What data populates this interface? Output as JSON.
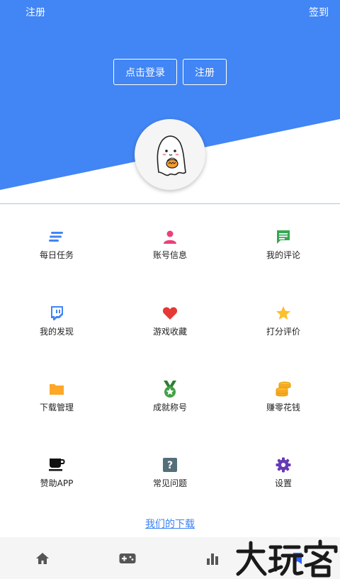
{
  "header": {
    "left_link": "注册",
    "right_link": "签到",
    "login_button": "点击登录",
    "register_button": "注册",
    "accent_color": "#4285f4"
  },
  "menu": [
    {
      "label": "每日任务",
      "icon": "tasks-icon"
    },
    {
      "label": "账号信息",
      "icon": "person-icon"
    },
    {
      "label": "我的评论",
      "icon": "comment-icon"
    },
    {
      "label": "我的发现",
      "icon": "discover-icon"
    },
    {
      "label": "游戏收藏",
      "icon": "heart-icon"
    },
    {
      "label": "打分评价",
      "icon": "star-icon"
    },
    {
      "label": "下载管理",
      "icon": "folder-icon"
    },
    {
      "label": "成就称号",
      "icon": "medal-icon"
    },
    {
      "label": "赚零花钱",
      "icon": "coins-icon"
    },
    {
      "label": "赞助APP",
      "icon": "coffee-icon"
    },
    {
      "label": "常见问题",
      "icon": "question-icon"
    },
    {
      "label": "设置",
      "icon": "gear-icon"
    }
  ],
  "download_link": "我们的下载",
  "bottom_nav": [
    "home-icon",
    "gamepad-icon",
    "chart-icon",
    "bookmark-icon"
  ],
  "watermark": {
    "text": "大玩客"
  }
}
